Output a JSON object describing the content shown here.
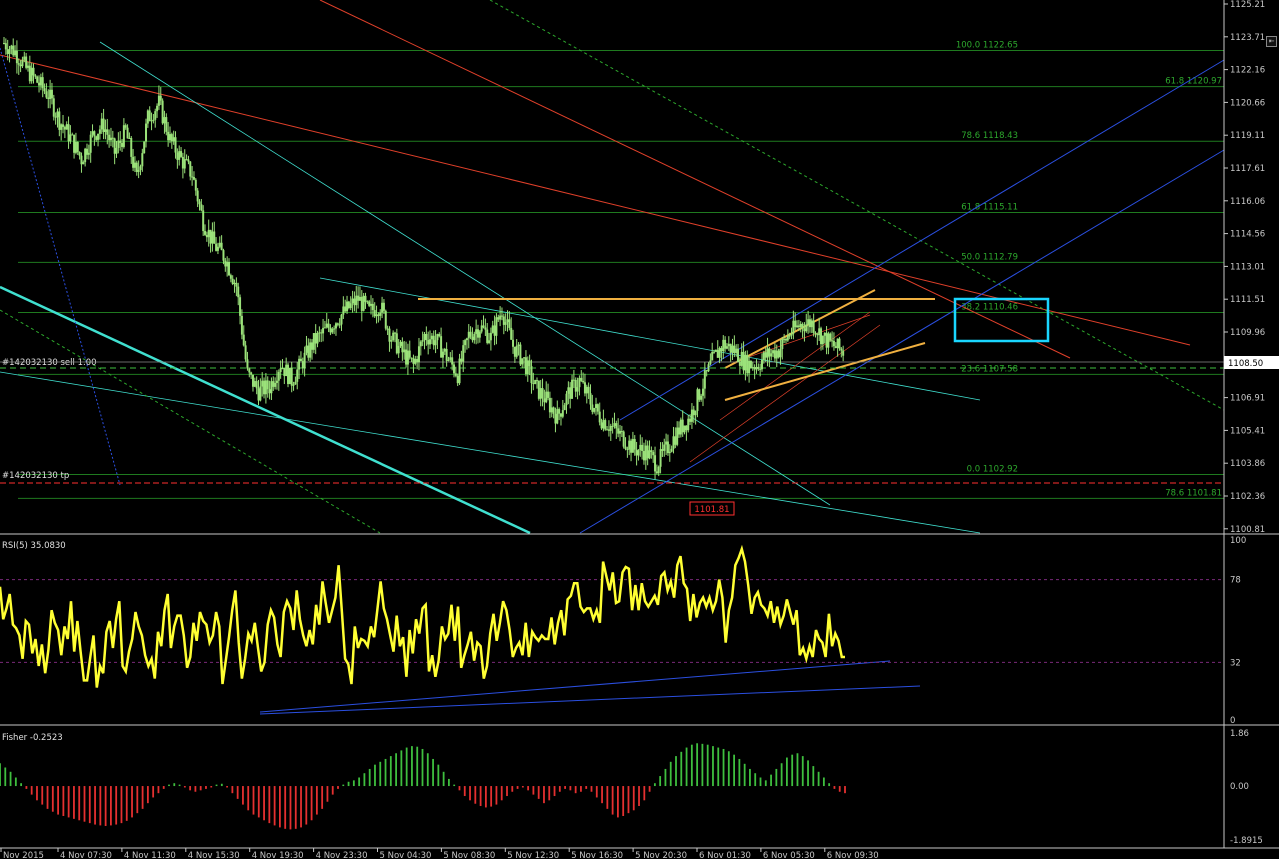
{
  "colors": {
    "background": "#000000",
    "candle": "#9be27a",
    "fib": "#1f7a1f",
    "fib_text": "#2da82d",
    "rsi": "#ffff33",
    "fisher_pos": "#3fbf3f",
    "fisher_neg": "#e53030",
    "trend_blue": "#2b4fe0",
    "trend_red": "#e0402a",
    "trend_cyan": "#40e0d0",
    "orange": "#f0b040",
    "target_box": "#1ad6ff",
    "price_box": "#ffffff",
    "tp_line": "#ff3030"
  },
  "header": {
    "title_fragment": ""
  },
  "fib_levels": [
    {
      "label": "100.0 1122.65",
      "price": 1122.65
    },
    {
      "label": "61.8 1120.97",
      "price": 1120.97
    },
    {
      "label": "78.6 1118.43",
      "price": 1118.43
    },
    {
      "label": "61.8 1115.11",
      "price": 1115.11
    },
    {
      "label": "50.0 1112.79",
      "price": 1112.79
    },
    {
      "label": "38.2 1110.46",
      "price": 1110.46
    },
    {
      "label": "23.6 1107.58",
      "price": 1107.58
    },
    {
      "label": "0.0 1102.92",
      "price": 1102.92
    },
    {
      "label": "78.6 1101.81",
      "price": 1101.81
    }
  ],
  "order_labels": {
    "sell": "#142032130 sell 1.00",
    "tp": "#142032130 tp"
  },
  "price_marker": "1101.81",
  "current_price": "1108.50",
  "rsi_title": "RSI(5) 35.0830",
  "fisher_title": "Fisher -0.2523",
  "scroll_icon": "⇤",
  "chart_data": [
    {
      "type": "candlestick",
      "title": "",
      "ylim": [
        1100.2,
        1125.0
      ],
      "y_ticks": [
        "1125.21",
        "1123.71",
        "1122.16",
        "1120.66",
        "1119.11",
        "1117.61",
        "1116.06",
        "1114.56",
        "1113.01",
        "1111.51",
        "1109.96",
        "1108.46",
        "1106.91",
        "1105.41",
        "1103.86",
        "1102.36",
        "1100.81"
      ],
      "x_labels": [
        "Nov 2015",
        "4 Nov 07:30",
        "4 Nov 11:30",
        "4 Nov 15:30",
        "4 Nov 19:30",
        "4 Nov 23:30",
        "5 Nov 04:30",
        "5 Nov 08:30",
        "5 Nov 12:30",
        "5 Nov 16:30",
        "5 Nov 20:30",
        "6 Nov 01:30",
        "6 Nov 05:30",
        "6 Nov 09:30"
      ],
      "close_path": [
        [
          0,
          1123.0
        ],
        [
          0.02,
          1122.6
        ],
        [
          0.04,
          1121.8
        ],
        [
          0.06,
          1121.2
        ],
        [
          0.08,
          1120.6
        ],
        [
          0.1,
          1119.4
        ],
        [
          0.12,
          1118.6
        ],
        [
          0.14,
          1117.6
        ],
        [
          0.16,
          1118.7
        ],
        [
          0.18,
          1119.2
        ],
        [
          0.2,
          1117.9
        ],
        [
          0.22,
          1118.9
        ],
        [
          0.24,
          1116.7
        ],
        [
          0.26,
          1119.5
        ],
        [
          0.28,
          1120.2
        ],
        [
          0.3,
          1118.5
        ],
        [
          0.32,
          1117.6
        ],
        [
          0.34,
          1116.9
        ],
        [
          0.36,
          1114.7
        ],
        [
          0.38,
          1113.6
        ],
        [
          0.4,
          1113.0
        ],
        [
          0.42,
          1111.7
        ],
        [
          0.44,
          1107.6
        ],
        [
          0.46,
          1106.8
        ],
        [
          0.48,
          1107.0
        ],
        [
          0.5,
          1108.1
        ],
        [
          0.52,
          1107.3
        ],
        [
          0.54,
          1108.2
        ],
        [
          0.56,
          1109.1
        ],
        [
          0.58,
          1109.6
        ],
        [
          0.6,
          1110.1
        ],
        [
          0.62,
          1110.6
        ],
        [
          0.64,
          1111.1
        ],
        [
          0.66,
          1110.5
        ],
        [
          0.68,
          1110.8
        ],
        [
          0.7,
          1109.3
        ],
        [
          0.72,
          1108.6
        ],
        [
          0.74,
          1108.0
        ],
        [
          0.76,
          1109.4
        ],
        [
          0.78,
          1109.2
        ],
        [
          0.8,
          1108.4
        ],
        [
          0.82,
          1107.6
        ],
        [
          0.84,
          1109.4
        ],
        [
          0.86,
          1109.8
        ],
        [
          0.88,
          1109.3
        ],
        [
          0.9,
          1110.6
        ],
        [
          0.92,
          1108.9
        ],
        [
          0.94,
          1108.2
        ],
        [
          0.96,
          1107.0
        ],
        [
          0.98,
          1106.4
        ],
        [
          1.0,
          1105.6
        ],
        [
          1.02,
          1106.7
        ],
        [
          1.04,
          1107.3
        ],
        [
          1.06,
          1106.3
        ],
        [
          1.08,
          1105.5
        ],
        [
          1.1,
          1105.1
        ],
        [
          1.12,
          1104.6
        ],
        [
          1.14,
          1104.1
        ],
        [
          1.16,
          1104.0
        ],
        [
          1.18,
          1103.4
        ],
        [
          1.2,
          1104.2
        ],
        [
          1.22,
          1105.0
        ],
        [
          1.24,
          1105.6
        ],
        [
          1.26,
          1106.9
        ],
        [
          1.28,
          1108.2
        ],
        [
          1.3,
          1109.0
        ],
        [
          1.32,
          1108.7
        ],
        [
          1.34,
          1108.1
        ],
        [
          1.36,
          1108.0
        ],
        [
          1.38,
          1108.5
        ],
        [
          1.4,
          1108.7
        ],
        [
          1.42,
          1109.5
        ],
        [
          1.44,
          1109.9
        ],
        [
          1.46,
          1110.0
        ],
        [
          1.48,
          1109.3
        ],
        [
          1.5,
          1108.9
        ],
        [
          1.52,
          1108.6
        ]
      ]
    },
    {
      "type": "line",
      "title": "RSI(5) 35.0830",
      "ylim": [
        0,
        100
      ],
      "y_ticks": [
        "100",
        "78",
        "32",
        "0"
      ],
      "levels": [
        78,
        32
      ],
      "values": [
        74,
        56,
        62,
        70,
        53,
        51,
        47,
        34,
        55,
        53,
        37,
        45,
        30,
        42,
        26,
        39,
        61,
        54,
        50,
        36,
        52,
        45,
        66,
        38,
        55,
        38,
        22,
        22,
        35,
        47,
        18,
        30,
        26,
        49,
        55,
        40,
        56,
        66,
        30,
        27,
        38,
        45,
        60,
        52,
        47,
        36,
        30,
        34,
        23,
        49,
        41,
        61,
        70,
        40,
        52,
        58,
        58,
        47,
        29,
        35,
        54,
        44,
        60,
        55,
        53,
        43,
        47,
        60,
        52,
        20,
        33,
        46,
        61,
        72,
        43,
        23,
        34,
        48,
        44,
        54,
        40,
        27,
        32,
        53,
        61,
        57,
        42,
        35,
        60,
        66,
        62,
        50,
        72,
        56,
        47,
        41,
        50,
        42,
        64,
        53,
        77,
        65,
        54,
        61,
        68,
        86,
        60,
        34,
        31,
        20,
        52,
        40,
        45,
        44,
        41,
        52,
        46,
        61,
        77,
        62,
        56,
        47,
        38,
        58,
        41,
        46,
        24,
        50,
        37,
        56,
        48,
        62,
        64,
        27,
        36,
        24,
        33,
        52,
        45,
        48,
        64,
        44,
        63,
        29,
        36,
        42,
        49,
        33,
        43,
        41,
        23,
        30,
        48,
        59,
        44,
        54,
        66,
        61,
        50,
        35,
        40,
        43,
        36,
        54,
        35,
        49,
        46,
        44,
        47,
        45,
        45,
        57,
        42,
        54,
        61,
        47,
        67,
        69,
        76,
        76,
        63,
        60,
        62,
        62,
        56,
        61,
        54,
        88,
        80,
        72,
        82,
        65,
        66,
        82,
        85,
        84,
        61,
        75,
        61,
        76,
        66,
        63,
        66,
        69,
        64,
        80,
        82,
        72,
        77,
        68,
        86,
        91,
        76,
        73,
        55,
        70,
        57,
        65,
        68,
        63,
        68,
        61,
        66,
        78,
        68,
        43,
        61,
        68,
        86,
        90,
        95,
        88,
        75,
        59,
        68,
        71,
        64,
        62,
        58,
        66,
        54,
        63,
        53,
        58,
        67,
        60,
        53,
        61,
        36,
        40,
        34,
        41,
        35,
        50,
        45,
        43,
        35,
        59,
        41,
        48,
        44,
        35,
        35
      ]
    },
    {
      "type": "bar",
      "title": "Fisher -0.2523",
      "ylim": [
        -1.8915,
        1.86
      ],
      "y_ticks": [
        "1.86",
        "0.00",
        "-1.8915"
      ],
      "values": [
        0.8,
        0.65,
        0.5,
        0.3,
        0.1,
        -0.1,
        -0.3,
        -0.5,
        -0.65,
        -0.8,
        -0.9,
        -1.0,
        -1.05,
        -1.1,
        -1.15,
        -1.2,
        -1.25,
        -1.3,
        -1.35,
        -1.38,
        -1.4,
        -1.38,
        -1.35,
        -1.3,
        -1.22,
        -1.1,
        -0.95,
        -0.8,
        -0.6,
        -0.4,
        -0.25,
        -0.1,
        0.05,
        0.1,
        0.05,
        -0.05,
        -0.15,
        -0.2,
        -0.15,
        -0.1,
        -0.05,
        0.05,
        0.08,
        -0.05,
        -0.25,
        -0.45,
        -0.65,
        -0.85,
        -1.0,
        -1.1,
        -1.2,
        -1.3,
        -1.38,
        -1.45,
        -1.5,
        -1.52,
        -1.5,
        -1.45,
        -1.35,
        -1.2,
        -1.0,
        -0.8,
        -0.55,
        -0.3,
        -0.1,
        0.05,
        0.15,
        0.2,
        0.3,
        0.45,
        0.6,
        0.75,
        0.85,
        0.95,
        1.05,
        1.15,
        1.25,
        1.35,
        1.4,
        1.38,
        1.3,
        1.15,
        0.95,
        0.75,
        0.5,
        0.25,
        0.05,
        -0.15,
        -0.35,
        -0.5,
        -0.62,
        -0.7,
        -0.75,
        -0.72,
        -0.65,
        -0.5,
        -0.35,
        -0.2,
        -0.1,
        -0.05,
        -0.15,
        -0.3,
        -0.45,
        -0.6,
        -0.5,
        -0.35,
        -0.2,
        -0.1,
        -0.15,
        -0.25,
        -0.2,
        -0.1,
        -0.2,
        -0.4,
        -0.6,
        -0.8,
        -1.0,
        -1.1,
        -1.05,
        -0.95,
        -0.85,
        -0.7,
        -0.5,
        -0.2,
        0.1,
        0.35,
        0.6,
        0.85,
        1.05,
        1.2,
        1.35,
        1.45,
        1.5,
        1.48,
        1.45,
        1.4,
        1.35,
        1.3,
        1.22,
        1.1,
        0.95,
        0.78,
        0.6,
        0.45,
        0.3,
        0.2,
        0.4,
        0.6,
        0.8,
        1.0,
        1.1,
        1.15,
        1.05,
        0.9,
        0.7,
        0.5,
        0.3,
        0.1,
        -0.1,
        -0.2,
        -0.25
      ]
    }
  ]
}
